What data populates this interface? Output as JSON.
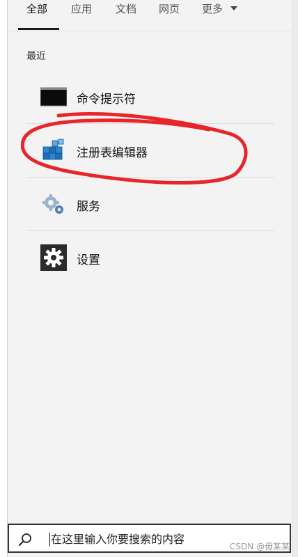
{
  "tabs": [
    {
      "label": "全部",
      "active": true
    },
    {
      "label": "应用",
      "active": false
    },
    {
      "label": "文档",
      "active": false
    },
    {
      "label": "网页",
      "active": false
    },
    {
      "label": "更多",
      "active": false,
      "dropdown": true
    }
  ],
  "recent": {
    "label": "最近",
    "items": [
      {
        "label": "命令提示符",
        "icon": "command-prompt-icon"
      },
      {
        "label": "注册表编辑器",
        "icon": "registry-editor-icon",
        "highlighted": true
      },
      {
        "label": "服务",
        "icon": "services-gear-icon"
      },
      {
        "label": "设置",
        "icon": "settings-gear-icon"
      }
    ]
  },
  "search": {
    "placeholder": "在这里输入你要搜索的内容",
    "value": ""
  },
  "watermark": "CSDN @毋某某",
  "colors": {
    "annotation": "#e8252a",
    "settings_bg": "#2b2b2b",
    "registry_blue": "#1c6fb8"
  }
}
